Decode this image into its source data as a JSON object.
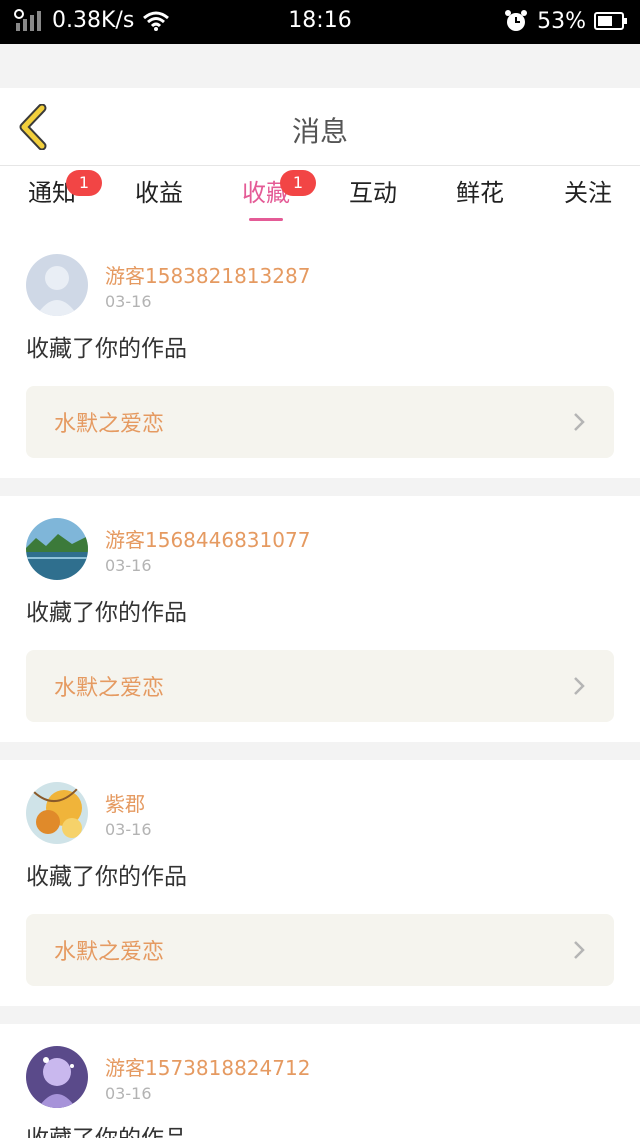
{
  "status_bar": {
    "net_speed": "0.38K/s",
    "time": "18:16",
    "battery": "53%"
  },
  "header": {
    "title": "消息"
  },
  "tabs": [
    {
      "label": "通知",
      "badge": "1",
      "active": false
    },
    {
      "label": "收益",
      "badge": "",
      "active": false
    },
    {
      "label": "收藏",
      "badge": "1",
      "active": true
    },
    {
      "label": "互动",
      "badge": "",
      "active": false
    },
    {
      "label": "鲜花",
      "badge": "",
      "active": false
    },
    {
      "label": "关注",
      "badge": "",
      "active": false
    }
  ],
  "feed": [
    {
      "username": "游客1583821813287",
      "date": "03-16",
      "action": "收藏了你的作品",
      "work_title": "水默之爱恋",
      "avatar": "default-avatar-icon"
    },
    {
      "username": "游客1568446831077",
      "date": "03-16",
      "action": "收藏了你的作品",
      "work_title": "水默之爱恋",
      "avatar": "lake-landscape-avatar"
    },
    {
      "username": "紫郡",
      "date": "03-16",
      "action": "收藏了你的作品",
      "work_title": "水默之爱恋",
      "avatar": "autumn-leaves-avatar"
    },
    {
      "username": "游客1573818824712",
      "date": "03-16",
      "action": "收藏了你的作品",
      "work_title": "",
      "avatar": "purple-anime-avatar"
    }
  ],
  "colors": {
    "accent_pink": "#e45b96",
    "username_orange": "#e59a61",
    "badge_red": "#f24545",
    "back_arrow_yellow": "#f2cf3c"
  }
}
